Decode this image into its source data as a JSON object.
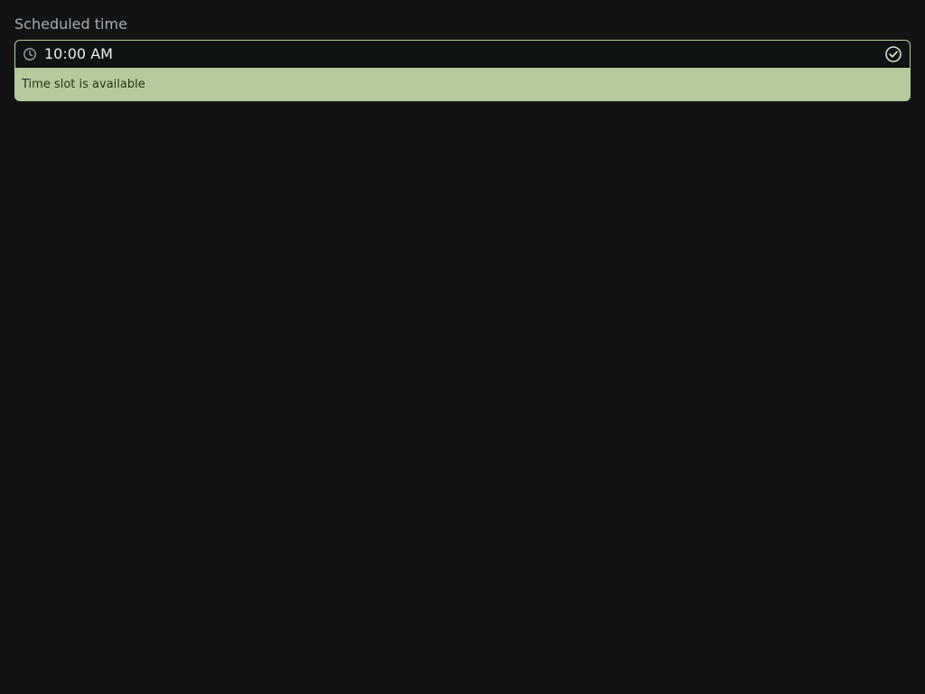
{
  "scheduled_time": {
    "label": "Scheduled time",
    "value": "10:00 AM",
    "leading_icon": "clock-icon",
    "status_icon": "check-circle-icon",
    "status_message": "Time slot is available",
    "status": "available"
  },
  "colors": {
    "page_background": "#131313",
    "label_text": "#a5adb3",
    "input_background": "#0f1314",
    "input_text": "#e9eef0",
    "success_background": "#b6ca9c",
    "success_text": "#25331c",
    "success_border": "#b8cfa0"
  }
}
